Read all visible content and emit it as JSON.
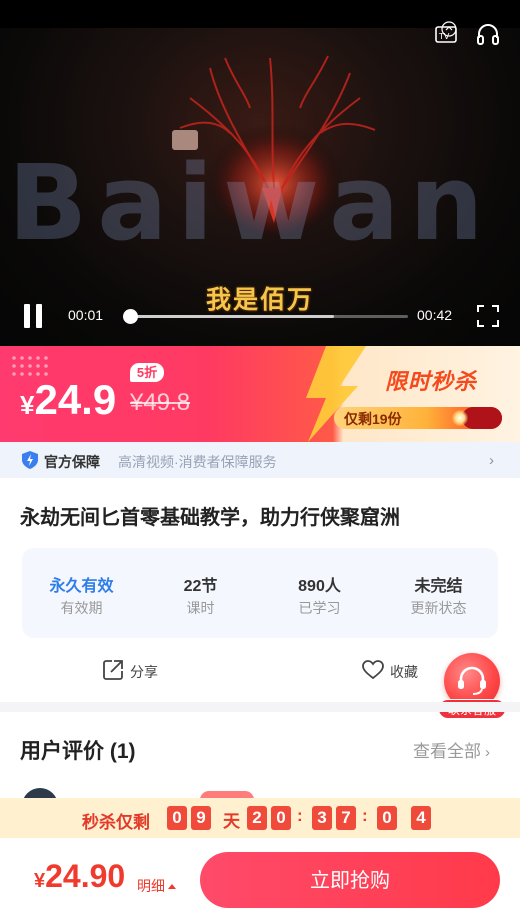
{
  "video": {
    "watermark": "Baiwan",
    "subtitle": "我是佰万",
    "current_time": "00:01",
    "duration": "00:42",
    "progress": 0.02,
    "buffered": 0.74
  },
  "price_banner": {
    "currency": "¥",
    "price": "24.9",
    "original_price": "¥49.8",
    "discount_badge": "5折",
    "flash_title": "限时秒杀",
    "stock_text": "仅剩19份"
  },
  "guarantee": {
    "title": "官方保障",
    "description": "高清视频·消费者保障服务"
  },
  "course": {
    "title": "永劫无间匕首零基础教学，助力行侠聚窟洲"
  },
  "stats": [
    {
      "value": "永久有效",
      "label": "有效期"
    },
    {
      "value": "22节",
      "label": "课时"
    },
    {
      "value": "890人",
      "label": "已学习"
    },
    {
      "value": "未完结",
      "label": "更新状态"
    }
  ],
  "actions": {
    "share_label": "分享",
    "favorite_label": "收藏"
  },
  "service": {
    "label": "联系客服"
  },
  "reviews": {
    "title": "用户评价 (1)",
    "view_all": "查看全部"
  },
  "countdown": {
    "label": "秒杀仅剩",
    "days": [
      "0",
      "9"
    ],
    "day_unit": "天",
    "hours": [
      "2",
      "0"
    ],
    "minutes": [
      "3",
      "7"
    ],
    "seconds": [
      "0",
      "4"
    ]
  },
  "bottom_bar": {
    "currency": "¥",
    "price": "24.90",
    "detail_label": "明细",
    "buy_label": "立即抢购"
  },
  "colors": {
    "accent_red": "#f03a2e",
    "accent_blue": "#2f7ee8",
    "banner_pink": "#ff3a6e"
  }
}
